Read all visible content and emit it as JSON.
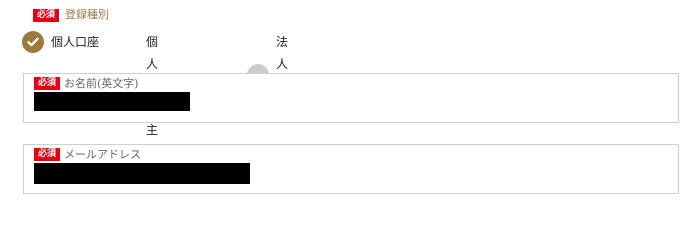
{
  "registration_type": {
    "required_badge": "必須",
    "title": "登録種別",
    "options": [
      {
        "label": "個人口座",
        "selected": true
      },
      {
        "label": "個人事業主口座",
        "selected": false
      },
      {
        "label": "法人口座",
        "selected": false
      }
    ]
  },
  "name_field": {
    "required_badge": "必須",
    "label": "お名前(英文字)",
    "value_redacted": true
  },
  "email_field": {
    "required_badge": "必須",
    "label": "メールアドレス",
    "value_redacted": true
  },
  "colors": {
    "required_badge": "#e60012",
    "accent": "#9c7a3c",
    "radio_unselected": "#cccccc",
    "field_border": "#cfcfcf"
  },
  "icons": {
    "selected_radio": "checkmark-icon"
  }
}
